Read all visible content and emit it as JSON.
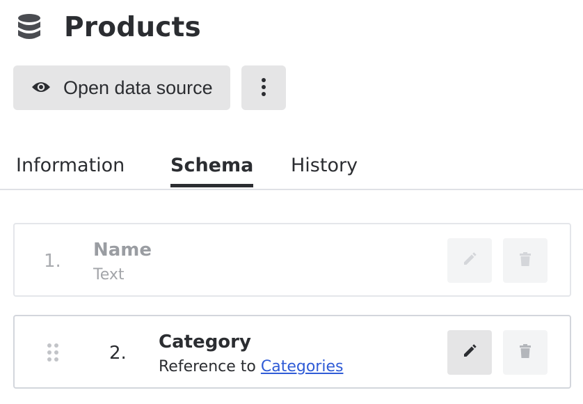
{
  "header": {
    "title": "Products",
    "icon": "database-icon"
  },
  "actions": {
    "open_label": "Open data source",
    "open_icon": "eye-icon",
    "more_icon": "more-vertical-icon"
  },
  "tabs": [
    {
      "label": "Information",
      "active": false
    },
    {
      "label": "Schema",
      "active": true
    },
    {
      "label": "History",
      "active": false
    }
  ],
  "schema": {
    "fields": [
      {
        "index": "1.",
        "name": "Name",
        "type_text": "Text",
        "editable": false,
        "deletable": false,
        "draggable": false
      },
      {
        "index": "2.",
        "name": "Category",
        "type_prefix": "Reference to",
        "type_link": "Categories",
        "editable": true,
        "deletable": false,
        "draggable": true
      }
    ]
  },
  "colors": {
    "accent_link": "#2f5bd6",
    "text": "#2b2d31",
    "button_bg": "#e5e5e6"
  }
}
